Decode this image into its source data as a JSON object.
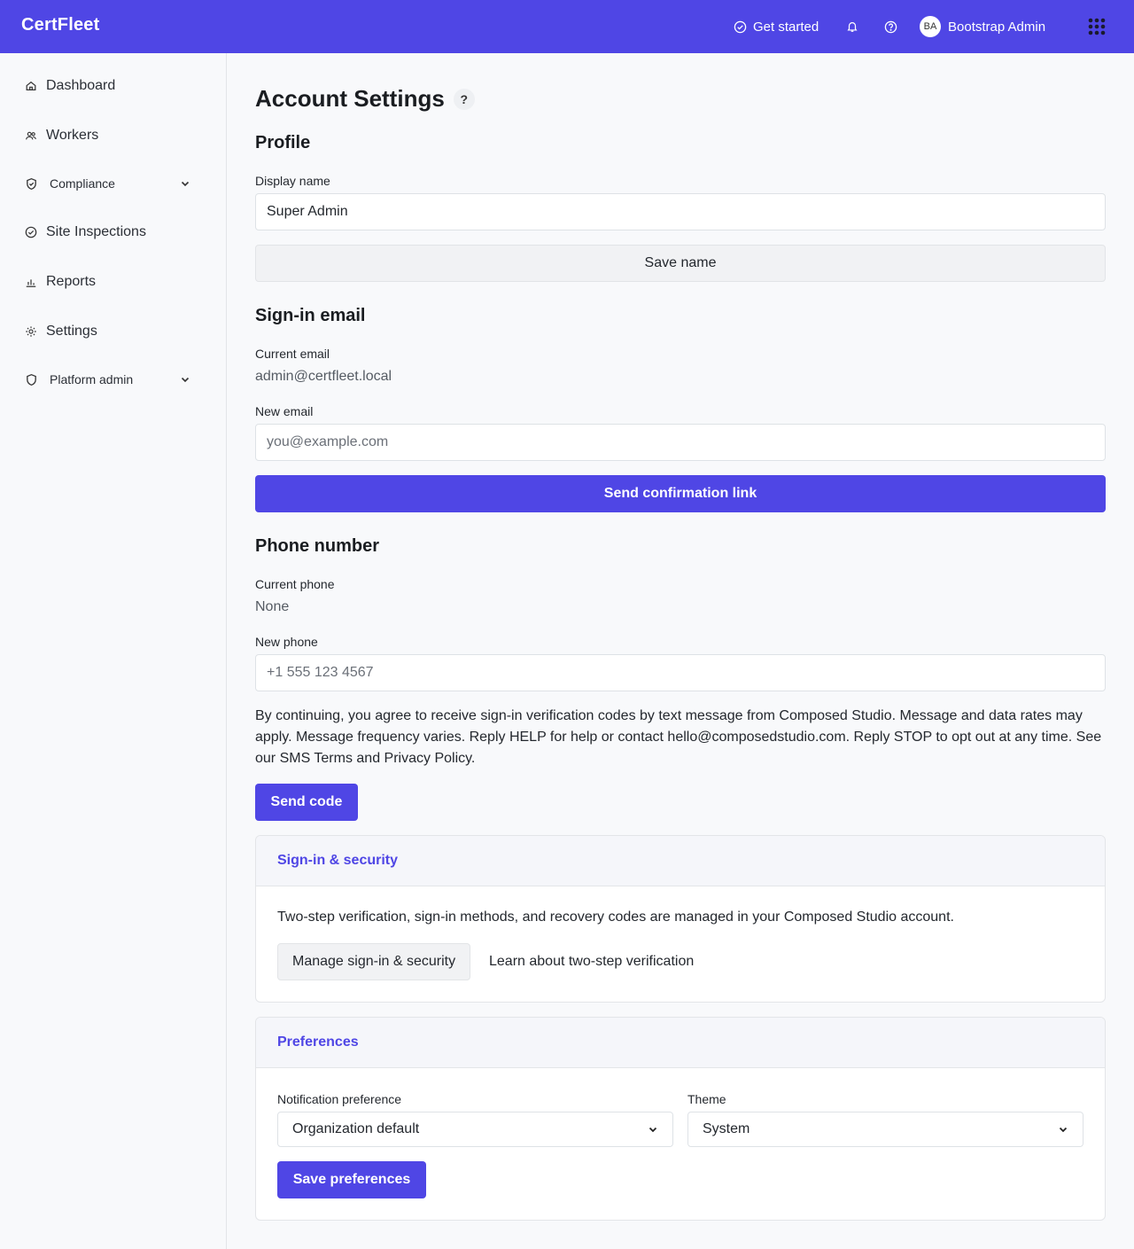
{
  "header": {
    "brand": "CertFleet",
    "get_started": "Get started",
    "user_initials": "BA",
    "user_name": "Bootstrap Admin"
  },
  "sidebar": {
    "items": [
      {
        "label": "Dashboard",
        "icon": "home-icon"
      },
      {
        "label": "Workers",
        "icon": "users-icon"
      },
      {
        "label": "Compliance",
        "icon": "shield-check-icon",
        "expandable": true
      },
      {
        "label": "Site Inspections",
        "icon": "check-circle-icon"
      },
      {
        "label": "Reports",
        "icon": "bar-chart-icon"
      },
      {
        "label": "Settings",
        "icon": "sun-gear-icon"
      },
      {
        "label": "Platform admin",
        "icon": "shield-icon",
        "expandable": true
      }
    ]
  },
  "page": {
    "title": "Account Settings",
    "help": "?"
  },
  "profile": {
    "title": "Profile",
    "display_name_label": "Display name",
    "display_name_value": "Super Admin",
    "save_label": "Save name"
  },
  "email": {
    "title": "Sign-in email",
    "current_label": "Current email",
    "current_value": "admin@certfleet.local",
    "new_label": "New email",
    "new_placeholder": "you@example.com",
    "send_label": "Send confirmation link"
  },
  "phone": {
    "title": "Phone number",
    "current_label": "Current phone",
    "current_value": "None",
    "new_label": "New phone",
    "new_placeholder": "+1 555 123 4567",
    "consent": "By continuing, you agree to receive sign-in verification codes by text message from Composed Studio. Message and data rates may apply. Message frequency varies. Reply HELP for help or contact hello@composedstudio.com. Reply STOP to opt out at any time. See our SMS Terms and Privacy Policy.",
    "send_code_label": "Send code"
  },
  "security": {
    "title": "Sign-in & security",
    "text": "Two-step verification, sign-in methods, and recovery codes are managed in your Composed Studio account.",
    "manage_label": "Manage sign-in & security",
    "learn_label": "Learn about two-step verification"
  },
  "preferences": {
    "title": "Preferences",
    "notification_label": "Notification preference",
    "notification_value": "Organization default",
    "theme_label": "Theme",
    "theme_value": "System",
    "save_label": "Save preferences"
  },
  "colors": {
    "accent": "#4f46e5",
    "background": "#f8f9fb"
  }
}
